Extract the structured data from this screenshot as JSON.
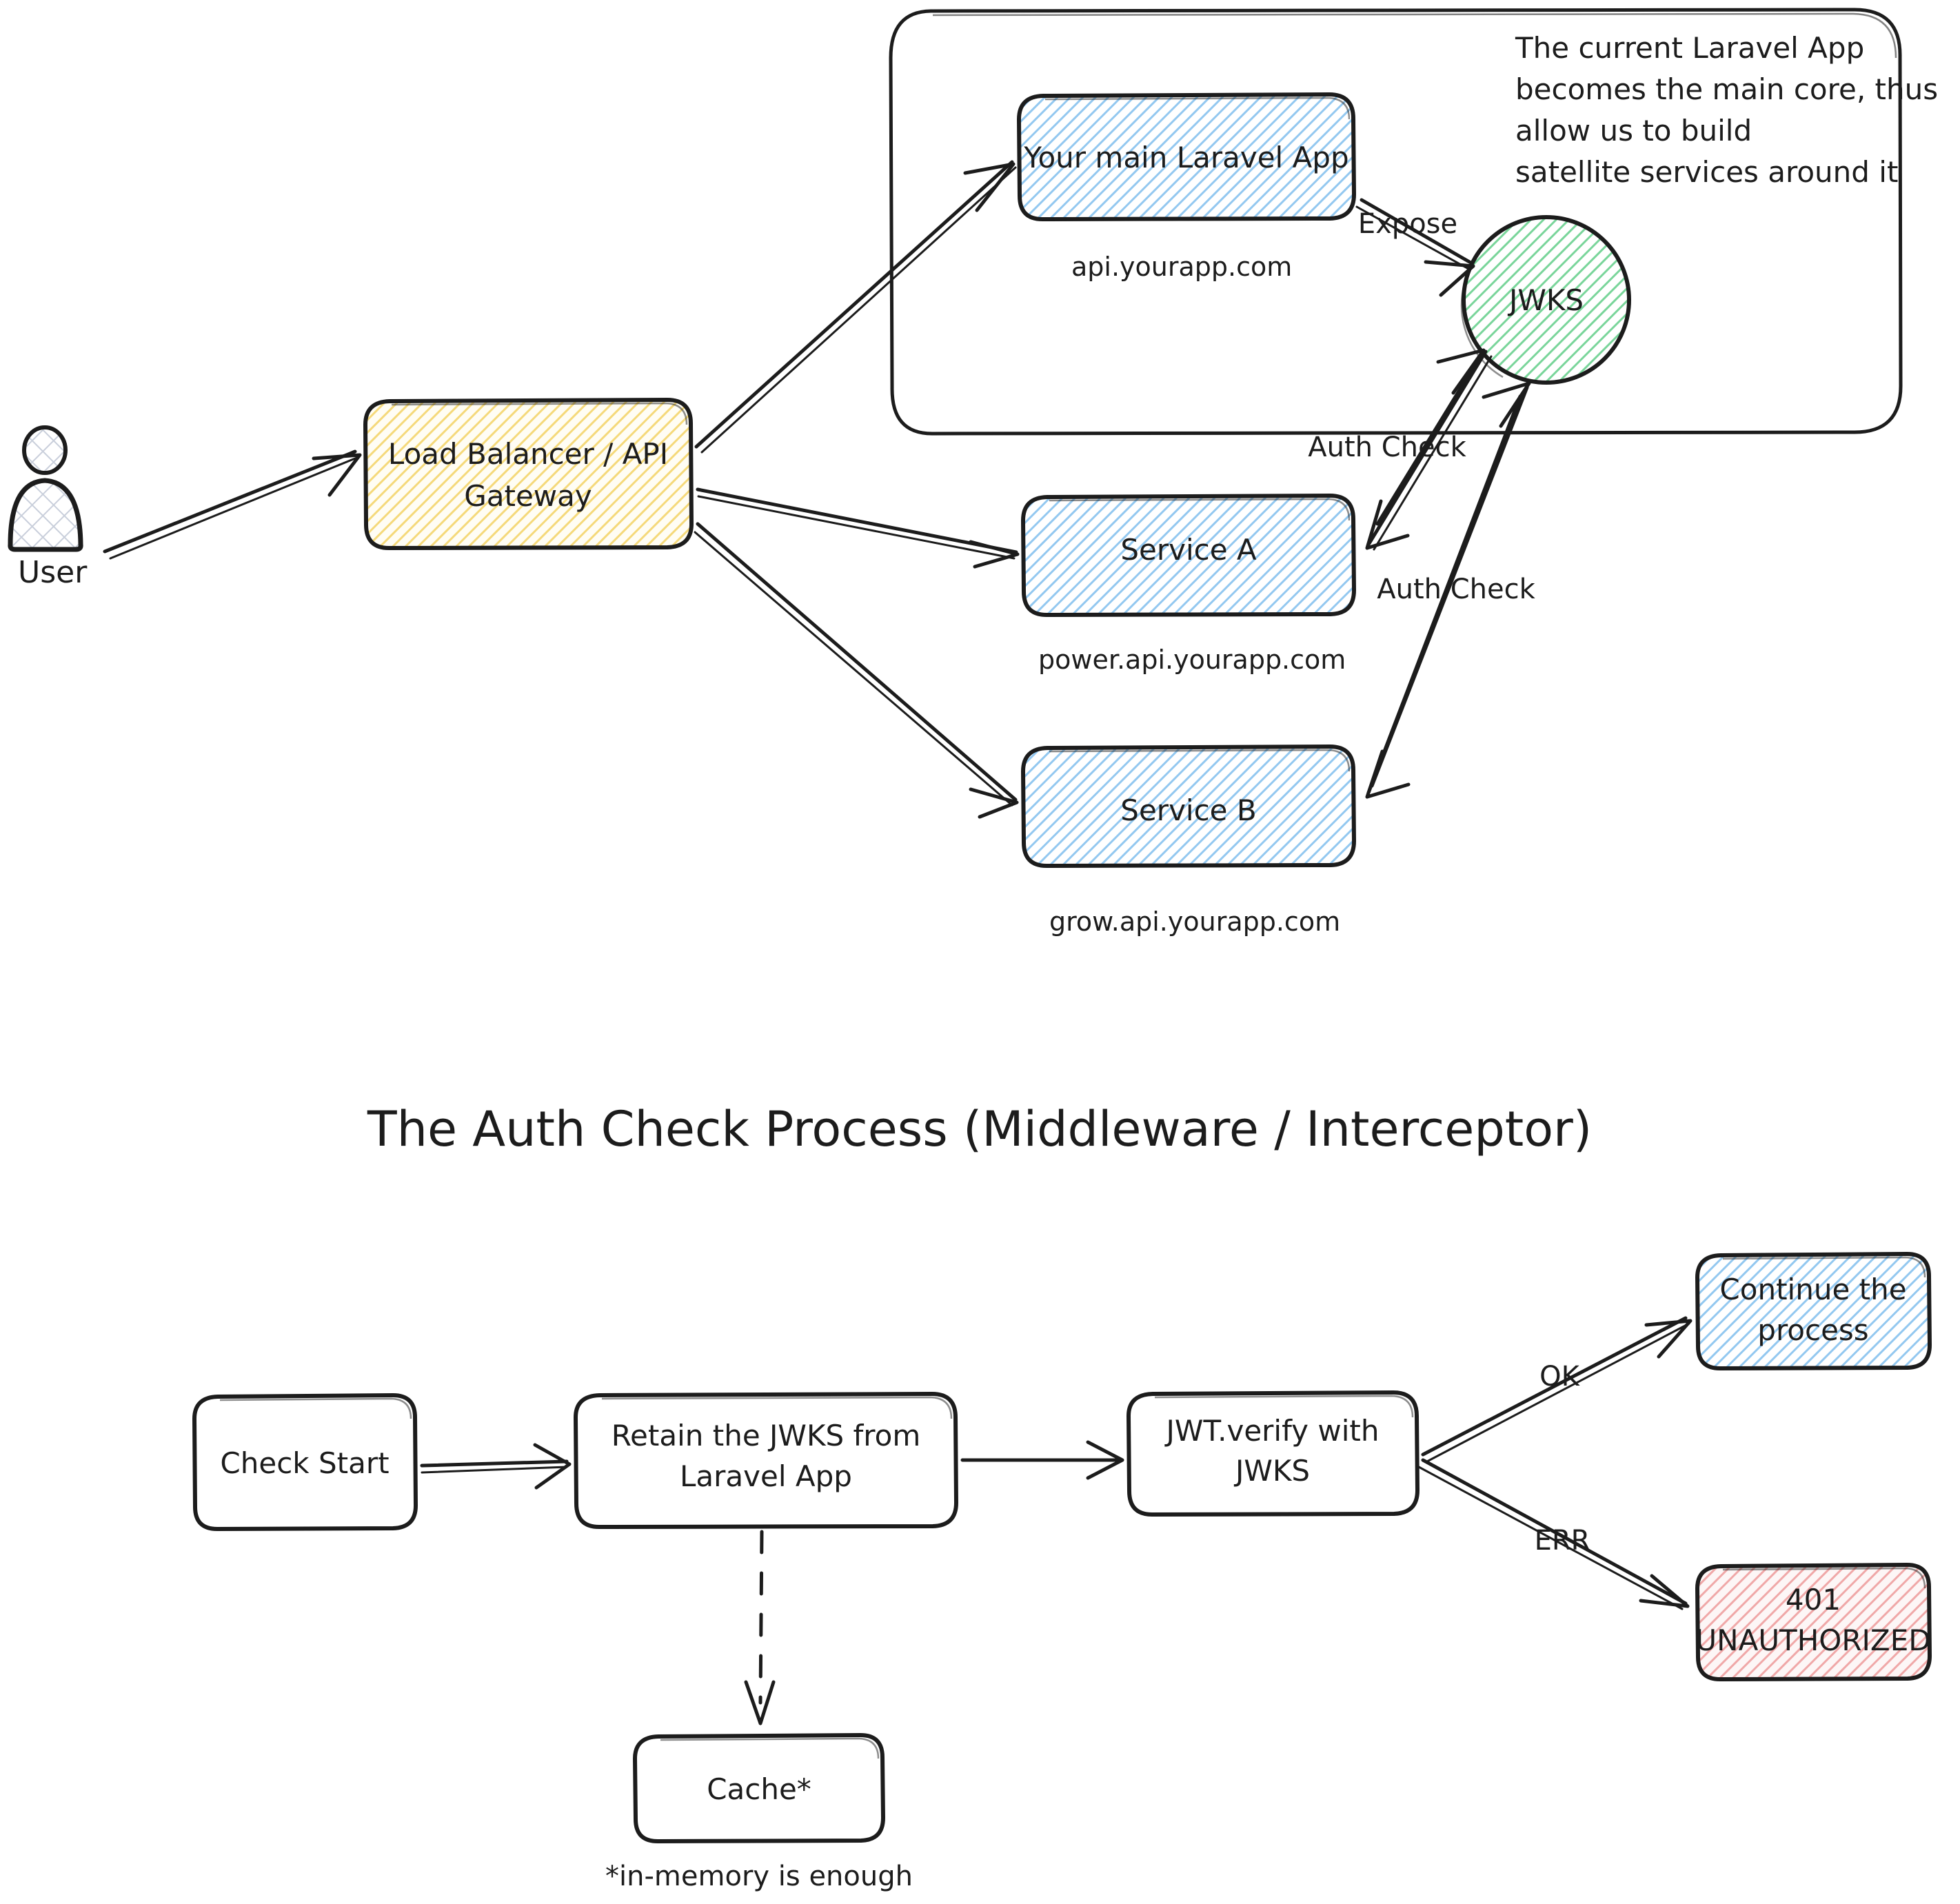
{
  "diagram": {
    "type": "architecture-flow",
    "background": "#ffffff",
    "stroke": "#1c1c1c"
  },
  "colors": {
    "blue_hatch": "#93c8f0",
    "blue_hatch_dark": "#6bb0e4",
    "yellow_hatch": "#f5d97a",
    "green_hatch": "#79d59a",
    "pink_hatch": "#f0a8a8",
    "grey_hatch": "#c9cfdb",
    "ink": "#1c1c1c"
  },
  "top_section": {
    "actor": {
      "label": "User",
      "icon": "user-avatar-icon"
    },
    "gateway": {
      "label_line1": "Load Balancer / API",
      "label_line2": "Gateway",
      "fill": "yellow_hatch"
    },
    "core_container": {
      "annotation_lines": [
        "The current Laravel App",
        "becomes the main core, thus",
        "allow us to build",
        "satellite services around it"
      ],
      "nodes": [
        {
          "id": "main-app",
          "label": "Your main Laravel App",
          "sublabel": "api.yourapp.com",
          "fill": "blue_hatch"
        },
        {
          "id": "jwks",
          "label": "JWKS",
          "shape": "circle",
          "fill": "green_hatch"
        }
      ]
    },
    "services": [
      {
        "id": "service-a",
        "label": "Service A",
        "sublabel": "power.api.yourapp.com",
        "fill": "blue_hatch"
      },
      {
        "id": "service-b",
        "label": "Service B",
        "sublabel": "grow.api.yourapp.com",
        "fill": "blue_hatch"
      }
    ],
    "edge_labels": {
      "expose": "Expose",
      "auth_check_a": "Auth Check",
      "auth_check_b": "Auth Check"
    }
  },
  "bottom_section": {
    "title": "The Auth Check Process (Middleware / Interceptor)",
    "nodes": [
      {
        "id": "check-start",
        "label_line1": "Check Start",
        "label_line2": "",
        "fill": "none"
      },
      {
        "id": "retain-jwks",
        "label_line1": "Retain the JWKS from",
        "label_line2": "Laravel App",
        "fill": "none"
      },
      {
        "id": "jwt-verify",
        "label_line1": "JWT.verify with",
        "label_line2": "JWKS",
        "fill": "none"
      },
      {
        "id": "continue",
        "label_line1": "Continue the",
        "label_line2": "process",
        "fill": "blue_hatch"
      },
      {
        "id": "unauthorized",
        "label_line1": "401",
        "label_line2": "UNAUTHORIZED",
        "fill": "pink_hatch"
      },
      {
        "id": "cache",
        "label_line1": "Cache*",
        "label_line2": "",
        "fill": "none"
      }
    ],
    "edge_labels": {
      "ok": "OK",
      "err": "ERR"
    },
    "footnote": "*in-memory is enough"
  }
}
